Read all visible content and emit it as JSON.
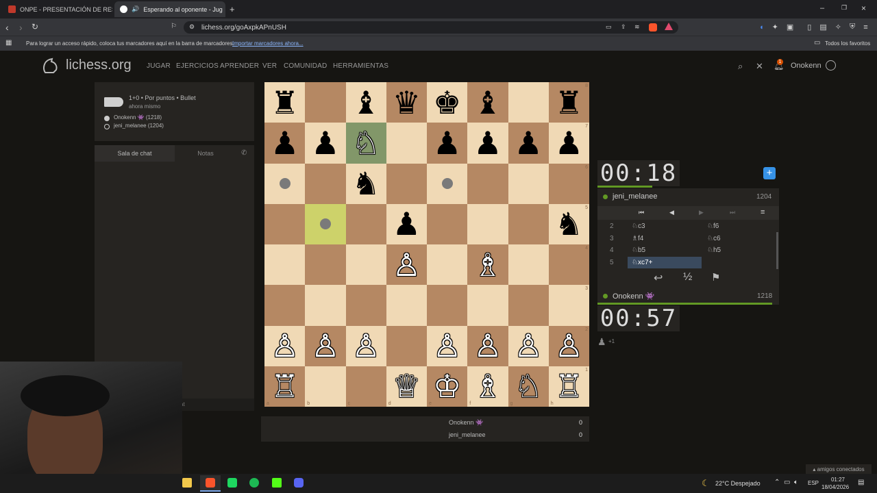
{
  "browser": {
    "tabs": [
      {
        "label": "ONPE - PRESENTACIÓN DE RESULTADO"
      },
      {
        "label": "Esperando al oponente - Jug"
      }
    ],
    "url": "lichess.org/goAxpkAPnUSH",
    "bookmarks_hint": "Para lograr un acceso rápido, coloca tus marcadores aquí en la barra de marcadores.",
    "bookmarks_link": "Importar marcadores ahora...",
    "all_bookmarks": "Todos los favoritos",
    "colors": {
      "accent": "#1a73e8",
      "brave": "#fb542b"
    }
  },
  "site": {
    "logo": "lichess.org",
    "nav": [
      "JUGAR",
      "EJERCICIOS",
      "APRENDER",
      "VER",
      "COMUNIDAD",
      "HERRAMIENTAS"
    ],
    "username": "Onokenn",
    "notification_count": "1"
  },
  "game": {
    "mode": "1+0 • Por puntos • Bullet",
    "time": "ahora mismo",
    "player_white": "Onokenn 👾 (1218)",
    "player_black": "jeni_melanee (1204)"
  },
  "chat": {
    "tab_chat": "Sala de chat",
    "tab_notes": "Notas",
    "input_partial": "at"
  },
  "board": {
    "ranks": [
      "8",
      "7",
      "6",
      "5",
      "4",
      "3",
      "2",
      "1"
    ],
    "files": [
      "a",
      "b",
      "c",
      "d",
      "e",
      "f",
      "g",
      "h"
    ],
    "squares": [
      [
        "♜",
        "",
        "♝",
        "♛",
        "♚",
        "♝",
        "",
        "♜"
      ],
      [
        "♟",
        "♟",
        "♘",
        "",
        "♟",
        "♟",
        "♟",
        "♟"
      ],
      [
        "",
        "",
        "♞",
        "",
        "",
        "",
        "",
        ""
      ],
      [
        "",
        "",
        "",
        "♟",
        "",
        "",
        "",
        "♞"
      ],
      [
        "",
        "",
        "",
        "♙",
        "",
        "♗",
        "",
        ""
      ],
      [
        "",
        "",
        "",
        "",
        "",
        "",
        "",
        ""
      ],
      [
        "♙",
        "♙",
        "♙",
        "",
        "♙",
        "♙",
        "♙",
        "♙"
      ],
      [
        "♖",
        "",
        "",
        "♕",
        "♔",
        "♗",
        "♘",
        "♖"
      ]
    ],
    "colors": {
      "light": "#f0d9b5",
      "dark": "#b58863",
      "highlight": "#cdd26a"
    }
  },
  "clocks": {
    "opponent_time": "00:18",
    "player_time": "00:57"
  },
  "players": {
    "opponent": {
      "name": "jeni_melanee",
      "rating": "1204"
    },
    "me": {
      "name": "Onokenn 👾",
      "rating": "1218"
    }
  },
  "moves": [
    {
      "num": "2",
      "white": "♘c3",
      "black": "♘f6"
    },
    {
      "num": "3",
      "white": "♗f4",
      "black": "♘c6"
    },
    {
      "num": "4",
      "white": "♘b5",
      "black": "♘h5"
    },
    {
      "num": "5",
      "white": "♘xc7+",
      "black": ""
    }
  ],
  "actions": {
    "takeback": "↩",
    "draw": "½",
    "resign": "⚑"
  },
  "captured": "+1",
  "score": {
    "row1": {
      "name": "Onokenn 👾",
      "points": "0"
    },
    "row2": {
      "name": "jeni_melanee",
      "points": "0"
    }
  },
  "friends": "amigos conectados",
  "taskbar": {
    "weather": "22°C Despejado",
    "lang": "ESP",
    "time": "01:27",
    "date": "18/04/2026"
  }
}
